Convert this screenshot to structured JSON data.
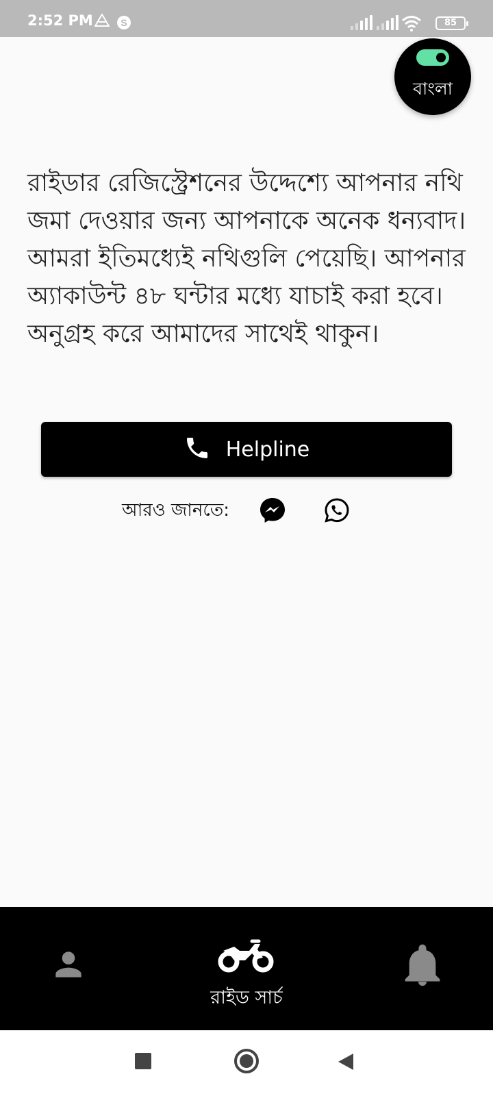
{
  "status_bar": {
    "time": "2:52 PM",
    "battery": "85",
    "icons": [
      "drive-icon",
      "s-icon",
      "signal-icon",
      "signal-icon",
      "wifi-icon",
      "battery-icon"
    ]
  },
  "language_toggle": {
    "label": "বাংলা",
    "state": "on",
    "track_color": "#62e0a6"
  },
  "message": "রাইডার রেজিস্ট্রেশনের উদ্দেশ্যে আপনার নথি জমা দেওয়ার জন্য আপনাকে অনেক ধন্যবাদ। আমরা ইতিমধ্যেই নথিগুলি পেয়েছি। আপনার অ্যাকাউন্ট ৪৮ ঘন্টার মধ্যে যাচাই করা হবে। অনুগ্রহ করে আমাদের সাথেই থাকুন।",
  "helpline_button": {
    "label": "Helpline",
    "icon": "phone-icon"
  },
  "know_more": {
    "label": "আরও জানতে:",
    "links": [
      "messenger-icon",
      "whatsapp-icon"
    ]
  },
  "bottom_nav": {
    "items": [
      {
        "icon": "person-icon",
        "label": ""
      },
      {
        "icon": "motorcycle-icon",
        "label": "রাইড সার্চ",
        "active": true
      },
      {
        "icon": "bell-icon",
        "label": ""
      }
    ],
    "active_color": "#ffffff",
    "inactive_color": "#8a8a8a"
  },
  "system_nav": [
    "recents-button",
    "home-button",
    "back-button"
  ]
}
